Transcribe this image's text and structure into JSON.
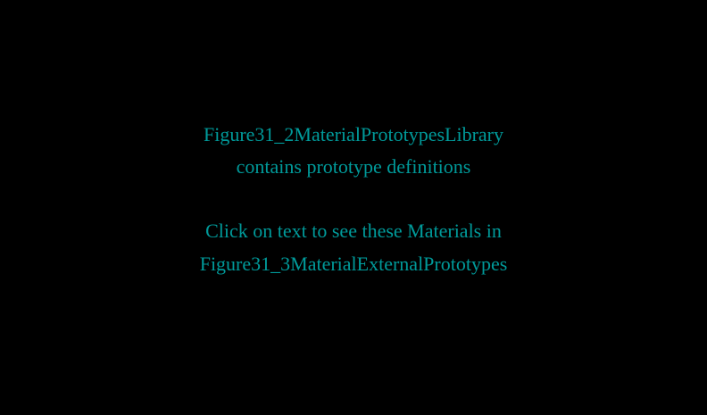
{
  "colors": {
    "background": "#000000",
    "text": "#009a9a"
  },
  "description_text": {
    "line1": "Figure31_2MaterialPrototypesLibrary",
    "line2": "contains prototype definitions"
  },
  "link_text": {
    "line1": "Click on text to see these Materials in",
    "line2": "Figure31_3MaterialExternalPrototypes"
  }
}
